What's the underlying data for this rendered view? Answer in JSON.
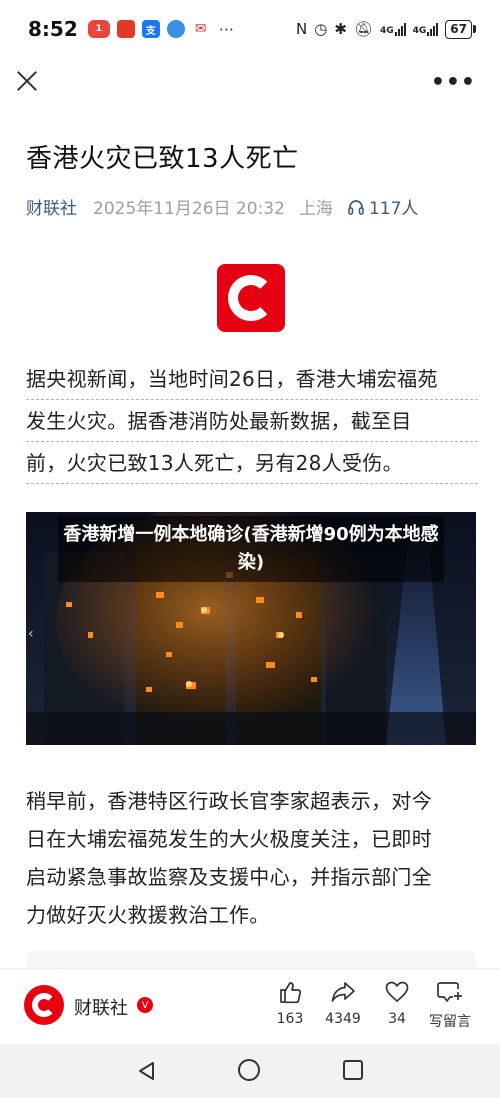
{
  "status_bar": {
    "time": "8:52",
    "notifications": [
      {
        "icon": "app-badge-icon",
        "text": "1",
        "color": "#e8453c"
      },
      {
        "icon": "red-app-icon",
        "text": "",
        "color": "#e0392b"
      },
      {
        "icon": "alipay-icon",
        "text": "支",
        "color": "#1677ff"
      },
      {
        "icon": "blue-app-icon",
        "text": "",
        "color": "#3a8ee6"
      },
      {
        "icon": "red-app-icon-2",
        "text": "",
        "color": "#d9342b"
      }
    ],
    "more": "···",
    "net_1": "4G",
    "net_2": "4G",
    "battery": "67"
  },
  "header": {
    "close_icon": "close-icon",
    "more_icon": "more-icon"
  },
  "article": {
    "title": "香港火灾已致13人死亡",
    "source": "财联社",
    "date": "2025年11月26日 20:32",
    "location": "上海",
    "listen_count": "117人",
    "paragraph_1_lines": [
      "据央视新闻，当地时间26日，香港大埔宏福苑",
      "发生火灾。据香港消防处最新数据，截至目",
      "前，火灾已致13人死亡，另有28人受伤。"
    ],
    "image_caption": "香港新增一例本地确诊(香港新增90例为本地感染)",
    "paragraph_2_lines": [
      "稍早前，香港特区行政长官李家超表示，对今",
      "日在大埔宏福苑发生的大火极度关注，已即时",
      "启动紧急事故监察及支援中心，并指示部门全",
      "力做好灭火救援救治工作。"
    ]
  },
  "action_bar": {
    "source_name": "财联社",
    "verified": "V",
    "like_count": "163",
    "share_count": "4349",
    "favorite_count": "34",
    "comment_label": "写留言"
  },
  "colors": {
    "brand_red": "#e60012",
    "source_blue": "#3d5a7e"
  }
}
